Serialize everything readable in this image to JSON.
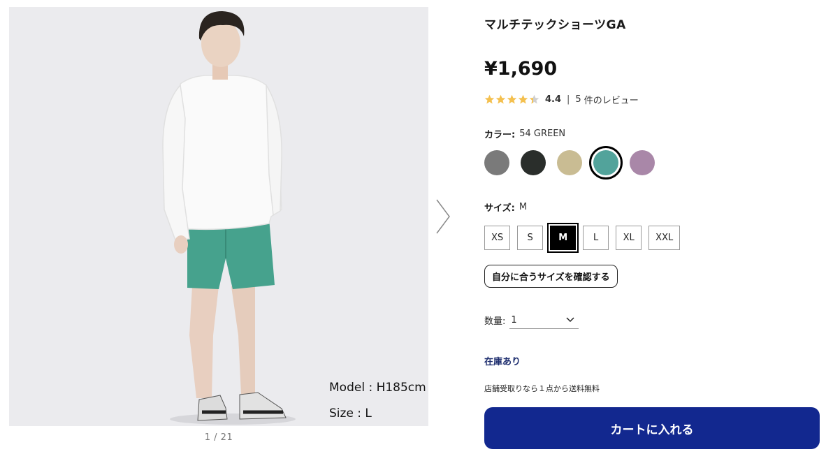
{
  "product": {
    "title": "マルチテックショーツGA",
    "price": "¥1,690",
    "rating": {
      "stars": 4.4,
      "value_label": "4.4",
      "separator": "|",
      "review_count": "5",
      "review_text": "件のレビュー"
    }
  },
  "gallery": {
    "counter": "1 / 21",
    "model_height": "Model : H185cm",
    "model_size": "Size : L",
    "next_icon": "chevron-right-icon"
  },
  "color": {
    "label": "カラー:",
    "selected": "54 GREEN",
    "swatches": [
      {
        "name": "gray",
        "hex": "#7a7a7a"
      },
      {
        "name": "black",
        "hex": "#2a2e2b"
      },
      {
        "name": "beige",
        "hex": "#c9bc93"
      },
      {
        "name": "green",
        "hex": "#52a39b",
        "selected": true
      },
      {
        "name": "purple",
        "hex": "#a987a8"
      }
    ]
  },
  "size": {
    "label": "サイズ:",
    "selected": "M",
    "options": [
      "XS",
      "S",
      "M",
      "L",
      "XL",
      "XXL"
    ]
  },
  "fit_button": "自分に合うサイズを確認する",
  "quantity": {
    "label": "数量:",
    "value": "1",
    "icon": "chevron-down-icon"
  },
  "stock": "在庫あり",
  "shipping": "店舗受取りなら１点から送料無料",
  "cart_button": "カートに入れる",
  "colors": {
    "cart": "#12288f",
    "star": "#f4c04f",
    "stock": "#1d2d6e"
  }
}
